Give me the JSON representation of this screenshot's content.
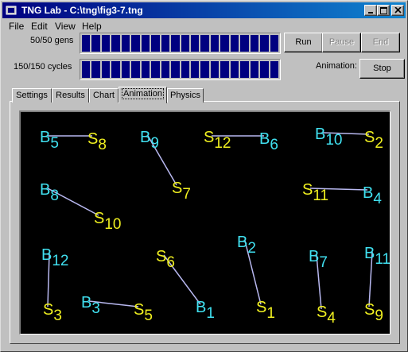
{
  "window": {
    "title": "TNG Lab - C:\\tng\\fig3-7.tng"
  },
  "menu": {
    "items": [
      "File",
      "Edit",
      "View",
      "Help"
    ]
  },
  "progress": {
    "gens_label": "50/50 gens",
    "gens_fraction": 1.0,
    "cycles_label": "150/150 cycles",
    "cycles_fraction": 1.0
  },
  "controls": {
    "run_label": "Run",
    "pause_label": "Pause",
    "end_label": "End",
    "animation_label": "Animation:",
    "stop_label": "Stop"
  },
  "tabs": [
    "Settings",
    "Results",
    "Chart",
    "Animation",
    "Physics"
  ],
  "active_tab": "Animation",
  "colors": {
    "buyer": "#40e0f0",
    "seller": "#f0f020",
    "link": "#b8b8f0",
    "background": "#000000",
    "progress": "#000080"
  },
  "animation": {
    "pairs": [
      {
        "a": "B5",
        "b": "S8"
      },
      {
        "a": "B9",
        "b": "S7"
      },
      {
        "a": "S12",
        "b": "B6"
      },
      {
        "a": "B10",
        "b": "S2"
      },
      {
        "a": "B8",
        "b": "S10"
      },
      {
        "a": "S11",
        "b": "B4"
      },
      {
        "a": "B12",
        "b": "S3"
      },
      {
        "a": "S6",
        "b": "B1"
      },
      {
        "a": "B2",
        "b": "S1"
      },
      {
        "a": "B7",
        "b": "S4"
      },
      {
        "a": "B11",
        "b": "S9"
      },
      {
        "a": "B3",
        "b": "S5"
      }
    ]
  }
}
